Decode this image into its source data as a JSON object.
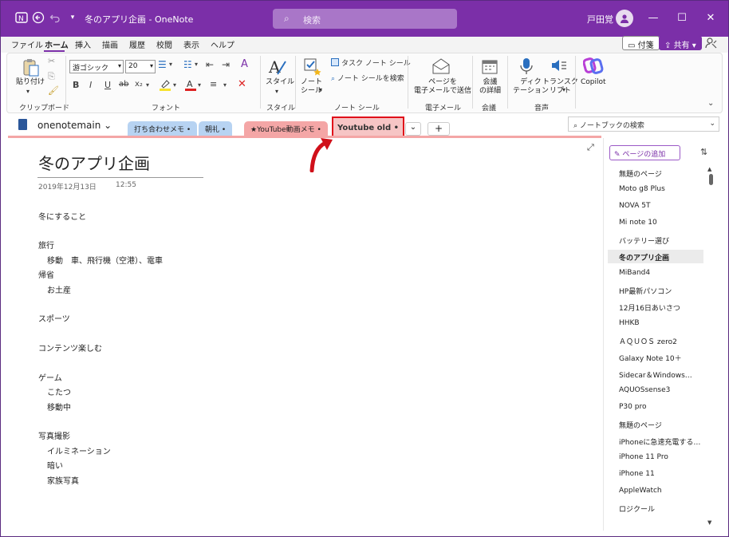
{
  "titlebar": {
    "title": "冬のアプリ企画  -  OneNote",
    "search_placeholder": "検索",
    "user_name": "戸田覚",
    "minimize": "—",
    "maximize": "☐",
    "close": "✕"
  },
  "menu": {
    "items": [
      "ファイル",
      "ホーム",
      "挿入",
      "描画",
      "履歴",
      "校閲",
      "表示",
      "ヘルプ"
    ],
    "active": "ホーム",
    "note_button": "付箋",
    "share_button": "共有"
  },
  "ribbon": {
    "paste": "貼り付け",
    "clipboard_group": "クリップボード",
    "font_name": "游ゴシック",
    "font_size": "20",
    "font_group": "フォント",
    "style_button": "スタイル",
    "style_group": "スタイル",
    "note_tag_button": "ノート\nシール",
    "task_tag": "タスク ノート シール",
    "find_tags": "ノート シールを検索",
    "note_tag_group": "ノート シール",
    "email_button": "ページを\n電子メールで送信",
    "email_group": "電子メール",
    "meeting_button": "会議\nの詳細",
    "meeting_group": "会議",
    "dictate_button": "ディク\nテーション",
    "transcribe_button": "トランスク\nリプト",
    "audio_group": "音声",
    "copilot_button": "Copilot"
  },
  "notebook": {
    "name": "onenotemain",
    "sections": [
      {
        "label": "打ち合わせメモ •",
        "color": "blue"
      },
      {
        "label": "朝礼 •",
        "color": "blue"
      },
      {
        "label": "★YouTube動画メモ •",
        "color": "pink"
      }
    ],
    "active_section": "Youtube old  •",
    "add_tab": "+",
    "search_placeholder": "ノートブックの検索"
  },
  "page": {
    "title": "冬のアプリ企画",
    "date": "2019年12月13日",
    "time": "12:55",
    "lines": [
      "冬にすること",
      "旅行",
      "移動　車、飛行機（空港）、電車",
      "帰省",
      "お土産",
      "スポーツ",
      "コンテンツ楽しむ",
      "ゲーム",
      "こたつ",
      "移動中",
      "写真撮影",
      "イルミネーション",
      "暗い",
      "家族写真"
    ]
  },
  "pages_panel": {
    "add_page": "ページの追加",
    "selected": "冬のアプリ企画",
    "items": [
      "無題のページ",
      "Moto g8 Plus",
      "NOVA 5T",
      "Mi note 10",
      "バッテリー選び",
      "冬のアプリ企画",
      "MiBand4",
      "HP最新パソコン",
      "12月16日あいさつ",
      "HHKB",
      "ＡＱＵＯＳ zero2",
      "Galaxy Note 10＋",
      "Sidecar＆Windows…",
      "AQUOSsense3",
      "P30 pro",
      "無題のページ",
      "iPhoneに急速充電する…",
      "iPhone 11  Pro",
      "iPhone 11",
      "AppleWatch",
      "ロジクール"
    ]
  },
  "colors": {
    "accent": "#7b2fa8",
    "section_blue": "#b7d3f2",
    "section_pink": "#f4a6a6",
    "highlight_red": "#e0101a"
  }
}
